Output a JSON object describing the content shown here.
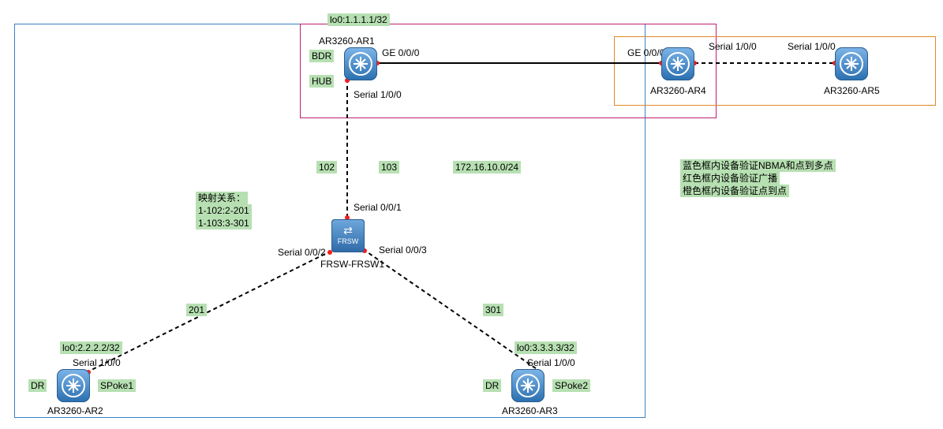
{
  "boxes": {
    "blue": {
      "color": "#3a80c6"
    },
    "red": {
      "color": "#c02070"
    },
    "orange": {
      "color": "#e08a2a"
    }
  },
  "devices": {
    "ar1": {
      "name": "AR3260-AR1",
      "lo": "lo0:1.1.1.1/32"
    },
    "ar2": {
      "name": "AR3260-AR2",
      "lo": "lo0:2.2.2.2/32"
    },
    "ar3": {
      "name": "AR3260-AR3",
      "lo": "lo0:3.3.3.3/32"
    },
    "ar4": {
      "name": "AR3260-AR4"
    },
    "ar5": {
      "name": "AR3260-AR5"
    },
    "frsw": {
      "name": "FRSW-FRSW1"
    }
  },
  "ports": {
    "ar1_ge": "GE 0/0/0",
    "ar1_ser": "Serial 1/0/0",
    "ar2_ser": "Serial 1/0/0",
    "ar3_ser": "Serial 1/0/0",
    "ar4_ge": "GE 0/0/0",
    "ar4_ser": "Serial 1/0/0",
    "ar5_ser": "Serial 1/0/0",
    "frsw_s1": "Serial 0/0/1",
    "frsw_s2": "Serial 0/0/2",
    "frsw_s3": "Serial 0/0/3"
  },
  "tags": {
    "bdr": "BDR",
    "hub": "HUB",
    "dr2": "DR",
    "spoke1": "SPoke1",
    "dr3": "DR",
    "spoke2": "SPoke2",
    "dlci102": "102",
    "dlci103": "103",
    "dlci201": "201",
    "dlci301": "301",
    "subnet": "172.16.10.0/24"
  },
  "mapping": {
    "title": "映射关系：",
    "l1": "1-102:2-201",
    "l2": "1-103:3-301"
  },
  "legend": {
    "l1": "蓝色框内设备验证NBMA和点到多点",
    "l2": "红色框内设备验证广播",
    "l3": "橙色框内设备验证点到点"
  },
  "chart_data": {
    "type": "table",
    "nodes": [
      {
        "id": "AR1",
        "model": "AR3260",
        "loopback": "1.1.1.1/32",
        "role": [
          "BDR",
          "HUB"
        ]
      },
      {
        "id": "AR2",
        "model": "AR3260",
        "loopback": "2.2.2.2/32",
        "role": [
          "DR",
          "SPoke1"
        ]
      },
      {
        "id": "AR3",
        "model": "AR3260",
        "loopback": "3.3.3.3/32",
        "role": [
          "DR",
          "SPoke2"
        ]
      },
      {
        "id": "AR4",
        "model": "AR3260"
      },
      {
        "id": "AR5",
        "model": "AR3260"
      },
      {
        "id": "FRSW1",
        "model": "FRSW"
      }
    ],
    "links": [
      {
        "a": "AR1",
        "a_port": "GE 0/0/0",
        "b": "AR4",
        "b_port": "GE 0/0/0",
        "style": "solid"
      },
      {
        "a": "AR4",
        "a_port": "Serial 1/0/0",
        "b": "AR5",
        "b_port": "Serial 1/0/0",
        "style": "dashed"
      },
      {
        "a": "AR1",
        "a_port": "Serial 1/0/0",
        "b": "FRSW1",
        "b_port": "Serial 0/0/1",
        "style": "dashed"
      },
      {
        "a": "FRSW1",
        "a_port": "Serial 0/0/2",
        "b": "AR2",
        "b_port": "Serial 1/0/0",
        "style": "dashed"
      },
      {
        "a": "FRSW1",
        "a_port": "Serial 0/0/3",
        "b": "AR3",
        "b_port": "Serial 1/0/0",
        "style": "dashed"
      }
    ],
    "dlci_map": [
      {
        "from": "1-102",
        "to": "2-201"
      },
      {
        "from": "1-103",
        "to": "3-301"
      }
    ],
    "subnet": "172.16.10.0/24",
    "groups": {
      "blue": "NBMA / point-to-multipoint",
      "red": "broadcast",
      "orange": "point-to-point"
    }
  }
}
